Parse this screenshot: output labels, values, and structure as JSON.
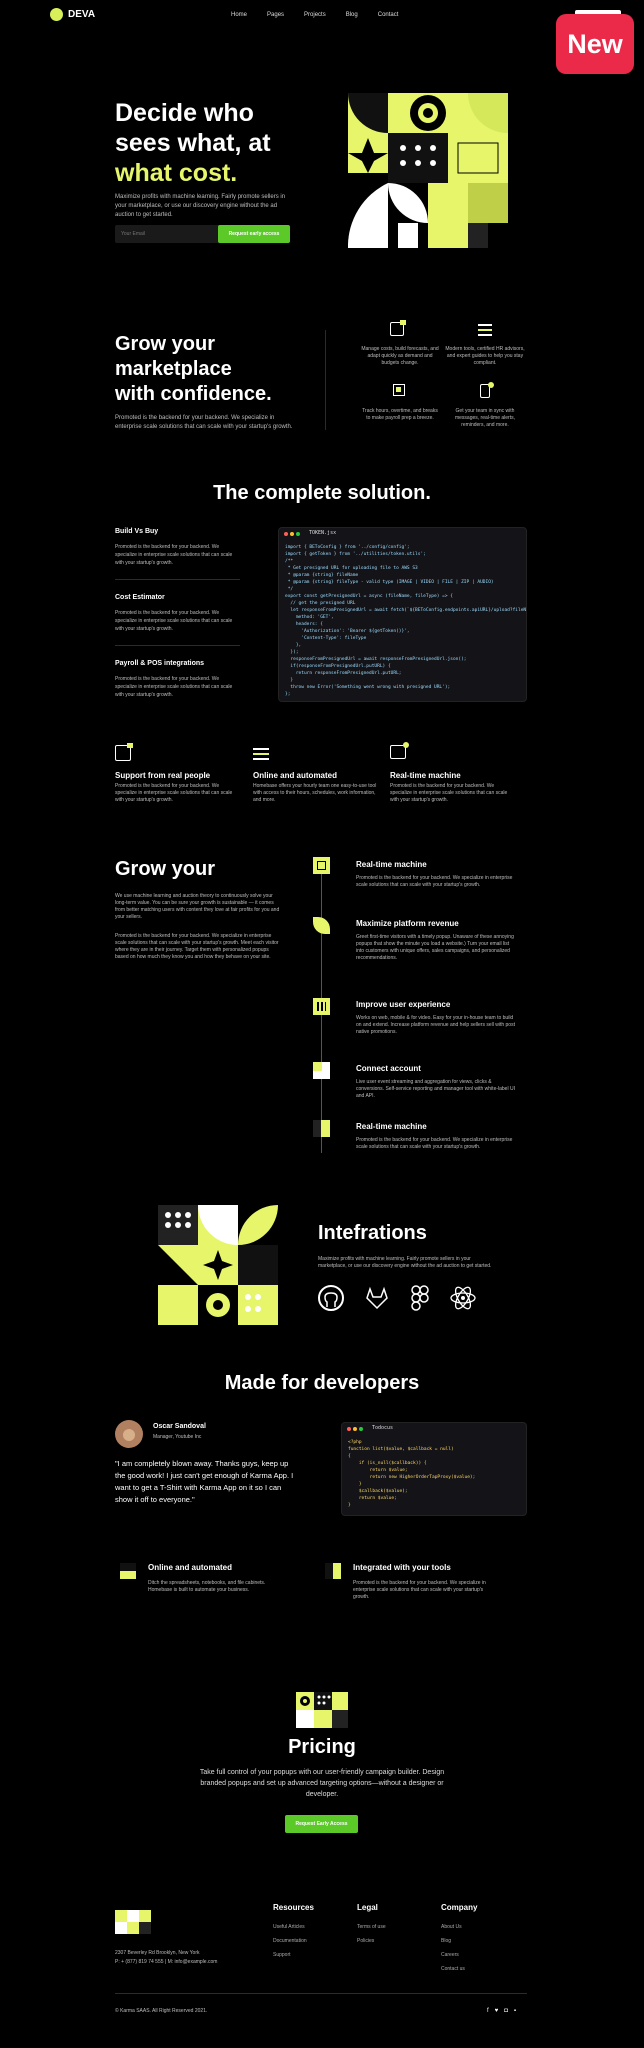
{
  "nav": {
    "brand": "DEVA",
    "items": [
      "Home",
      "Pages",
      "Projects",
      "Blog",
      "Contact"
    ],
    "badge": "New"
  },
  "hero": {
    "line1": "Decide who",
    "line2": "sees what, at",
    "highlight": "what cost.",
    "desc": "Maximize profits with machine learning. Fairly promote sellers in your marketplace, or use our discovery engine without the ad auction to get started.",
    "email_placeholder": "Your Email",
    "cta": "Request early access"
  },
  "grow": {
    "line1": "Grow your",
    "line2": "marketplace",
    "line3": "with confidence.",
    "desc": "Promoted is the backend for your backend. We specialize in enterprise scale solutions that can scale with your startup's growth.",
    "features": [
      {
        "icon": "chat-icon",
        "text": "Manage costs, build forecasts, and adapt quickly as demand and budgets change."
      },
      {
        "icon": "sliders-icon",
        "text": "Modern tools, certified HR advisors, and expert guides to help you stay compliant."
      },
      {
        "icon": "chip-icon",
        "text": "Track hours, overtime, and breaks to make payroll prep a breeze."
      },
      {
        "icon": "phone-icon",
        "text": "Get your team in sync with messages, real-time alerts, reminders, and more."
      }
    ]
  },
  "solution": {
    "title": "The complete solution.",
    "items": [
      {
        "title": "Build Vs Buy",
        "text": "Promoted is the backend for your backend. We specialize in enterprise scale solutions that can scale with your startup's growth."
      },
      {
        "title": "Cost Estimator",
        "text": "Promoted is the backend for your backend. We specialize in enterprise scale solutions that can scale with your startup's growth."
      },
      {
        "title": "Payroll & POS integrations",
        "text": "Promoted is the backend for your backend. We specialize in enterprise scale solutions that can scale with your startup's growth."
      }
    ],
    "code_tab": "TOKEN.jsx",
    "code": [
      "import { BEToConfig } from '../config/config';",
      "import { getToken } from '../utilities/token.utils';",
      "",
      "/**",
      " * Get presigned URL for uploading file to AWS S3",
      " * @param {string} fileName",
      " * @param {string} fileType - valid type (IMAGE | VIDEO | FILE | ZIP | AUDIO)",
      " */",
      "export const getPresignedUrl = async (fileName, fileType) => {",
      "  // get the presigned URL",
      "  let responseFromPresignedUrl = await fetch(`${BEToConfig.endpoints.apiURL}/upload?fileName=${fileName}`, {",
      "    method: 'GET',",
      "    headers: {",
      "      'Authorization': 'Bearer ${getToken()}',",
      "      'Content-Type': fileType",
      "    },",
      "  });",
      "",
      "  responseFromPresignedUrl = await responseFromPresignedUrl.json();",
      "",
      "  if(responseFromPresignedUrl.putURL) {",
      "    return responseFromPresignedUrl.putURL;",
      "  }",
      "",
      "  throw new Error('Something went wrong with presigned URL');",
      "};"
    ]
  },
  "features3": [
    {
      "icon": "chat-icon",
      "title": "Support from real people",
      "text": "Promoted is the backend for your backend. We specialize in enterprise scale solutions that can scale with your startup's growth."
    },
    {
      "icon": "sliders-icon",
      "title": "Online and automated",
      "text": "Homebase offers your hourly team one easy-to-use tool with access to their hours, schedules, work information, and more."
    },
    {
      "icon": "cart-icon",
      "title": "Real-time machine",
      "text": "Promoted is the backend for your backend. We specialize in enterprise scale solutions that can scale with your startup's growth."
    }
  ],
  "timeline": {
    "title": "Grow your",
    "p1": "We use machine learning and auction theory to continuously solve your long-term value. You can be sure your growth is sustainable — it comes from better matching users with content they love at fair profits for you and your sellers.",
    "p2": "Promoted is the backend for your backend. We specialize in enterprise scale solutions that can scale with your startup's growth. Meet each visitor where they are in their journey. Target them with personalized popups based on how much they know you and how they behave on your site.",
    "items": [
      {
        "title": "Real-time machine",
        "text": "Promoted is the backend for your backend. We specialize in enterprise scale solutions that can scale with your startup's growth."
      },
      {
        "title": "Maximize platform revenue",
        "text": "Greet first-time visitors with a timely popup. Unaware of these annoying popups that show the minute you load a website.) Turn your email list into customers with unique offers, sales campaigns, and personalized recommendations."
      },
      {
        "title": "Improve user experience",
        "text": "Works on web, mobile & for video. Easy for your in-house team to build on and extend. Increase platform revenue and help sellers sell with post native promotions."
      },
      {
        "title": "Connect account",
        "text": "Live user event streaming and aggregation for views, clicks & conversions. Self-service reporting and manager tool with white-label UI and API."
      },
      {
        "title": "Real-time machine",
        "text": "Promoted is the backend for your backend. We specialize in enterprise scale solutions that can scale with your startup's growth."
      }
    ]
  },
  "integrations": {
    "title": "Intefrations",
    "desc": "Maximize profits with machine learning. Fairly promote sellers in your marketplace, or use our discovery engine without the ad auction to get started.",
    "icons": [
      "github-icon",
      "gitlab-icon",
      "figma-icon",
      "react-icon"
    ]
  },
  "developers": {
    "title": "Made for developers",
    "name": "Oscar Sandoval",
    "role": "Manager, Youtube Inc",
    "quote": "\"I am completely blown away. Thanks guys, keep up the good work! I just can't get enough of Karma App. I want to get a T-Shirt with Karma App on it so I can show it off to everyone.\"",
    "code_tab": "Todocus",
    "code": [
      "<?php",
      "",
      "function list($value, $callback = null)",
      "{",
      "    if (is_null($callback)) {",
      "        return $value;",
      "        return new HigherOrderTapProxy($value);",
      "    }",
      "",
      "    $callback($value);",
      "",
      "    return $value;",
      "}"
    ]
  },
  "features2": [
    {
      "title": "Online and automated",
      "text": "Ditch the spreadsheets, notebooks, and file cabinets. Homebase is built to automate your business."
    },
    {
      "title": "Integrated with your tools",
      "text": "Promoted is the backend for your backend. We specialize in enterprise scale solutions that can scale with your startup's growth."
    }
  ],
  "pricing": {
    "title": "Pricing",
    "desc": "Take full control of your popups with our user-friendly campaign builder. Design branded popups and set up advanced targeting options—without a designer or developer.",
    "cta": "Request Early Access"
  },
  "footer": {
    "address": "2307 Beverley Rd Brooklyn, New York",
    "contact": "P: + (877) 819 74 555 | M: info@example.com",
    "cols": [
      {
        "title": "Resources",
        "links": [
          "Useful Articles",
          "Documentation",
          "Support"
        ]
      },
      {
        "title": "Legal",
        "links": [
          "Terms of use",
          "Policies"
        ]
      },
      {
        "title": "Company",
        "links": [
          "About Us",
          "Blog",
          "Careers",
          "Contact us"
        ]
      }
    ],
    "copyright": "© Karma SAAS. All Right Reserved 2021.",
    "social": [
      "facebook-icon",
      "twitter-icon",
      "instagram-icon",
      "linkedin-icon"
    ]
  },
  "colors": {
    "accent": "#e6f56a",
    "button": "#5bc928",
    "badge": "#ea2a48",
    "bg": "#000000"
  }
}
